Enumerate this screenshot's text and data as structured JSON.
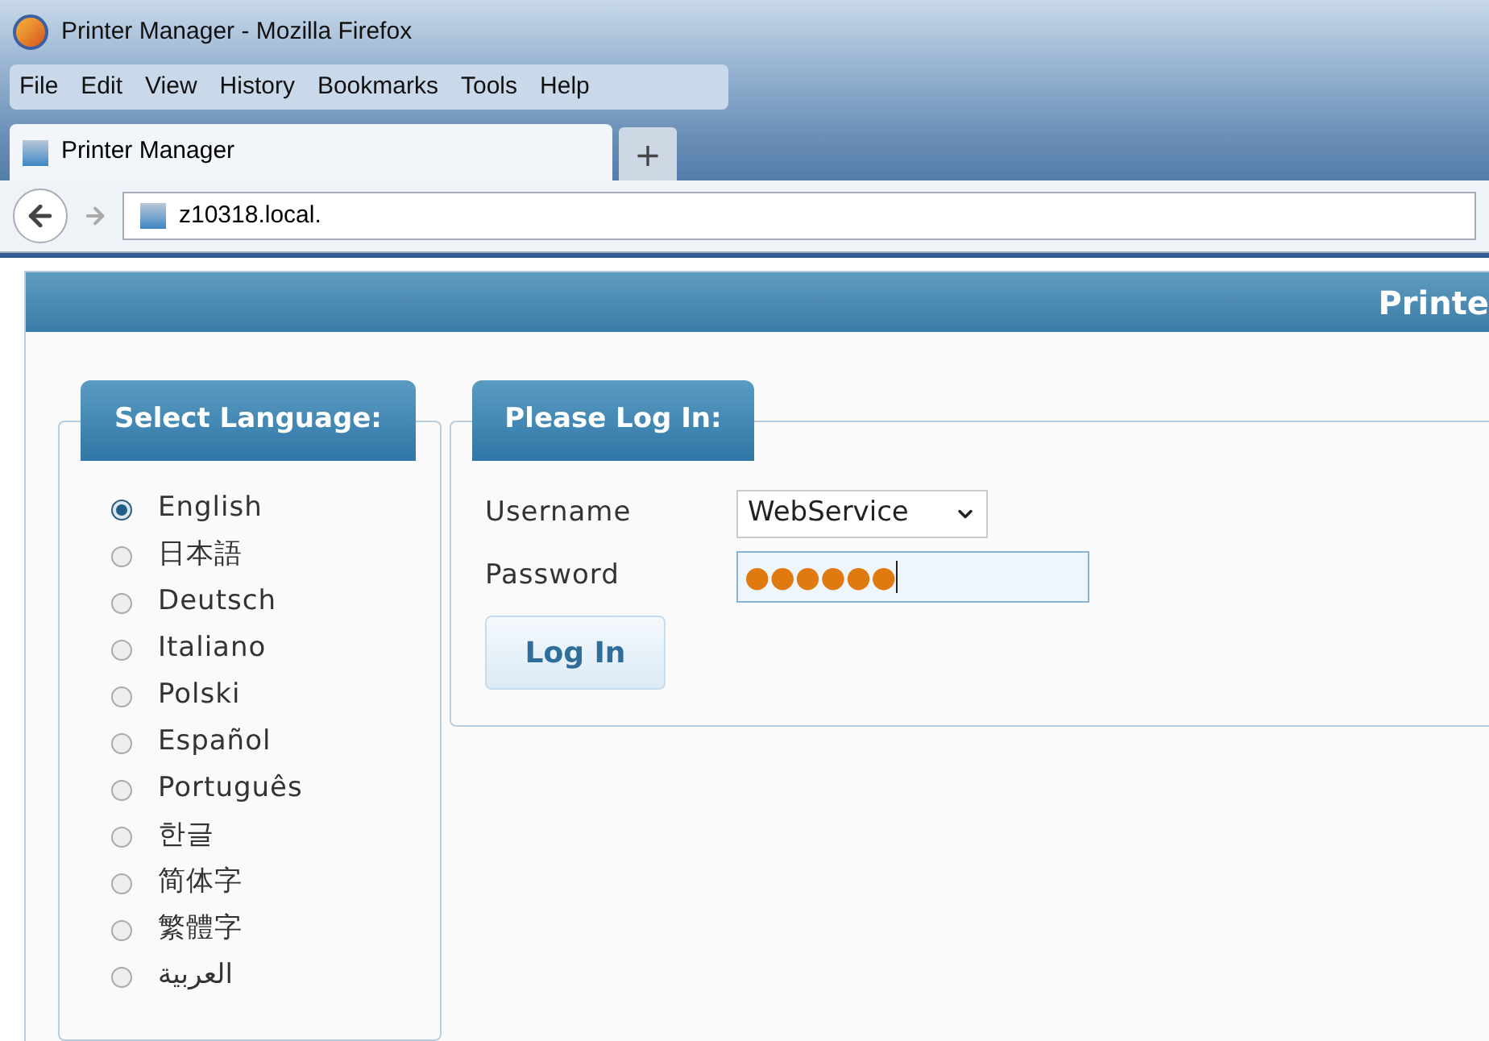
{
  "window": {
    "title": "Printer Manager - Mozilla Firefox"
  },
  "menu": [
    "File",
    "Edit",
    "View",
    "History",
    "Bookmarks",
    "Tools",
    "Help"
  ],
  "tabs": [
    {
      "label": "Printer Manager",
      "selected": true
    }
  ],
  "new_tab": "+",
  "address_bar": {
    "url": "z10318.local."
  },
  "header": {
    "title": "Printe"
  },
  "language_panel": {
    "legend": "Select Language:",
    "options": [
      {
        "label": "English",
        "selected": true
      },
      {
        "label": "日本語",
        "selected": false
      },
      {
        "label": "Deutsch",
        "selected": false
      },
      {
        "label": "Italiano",
        "selected": false
      },
      {
        "label": "Polski",
        "selected": false
      },
      {
        "label": "Español",
        "selected": false
      },
      {
        "label": "Português",
        "selected": false
      },
      {
        "label": "한글",
        "selected": false
      },
      {
        "label": "简体字",
        "selected": false
      },
      {
        "label": "繁體字",
        "selected": false
      },
      {
        "label": "العربية",
        "selected": false
      }
    ]
  },
  "login_panel": {
    "legend": "Please Log In:",
    "username_label": "Username",
    "username_value": "WebService",
    "password_label": "Password",
    "password_value": "●●●●●●",
    "button": "Log In"
  }
}
